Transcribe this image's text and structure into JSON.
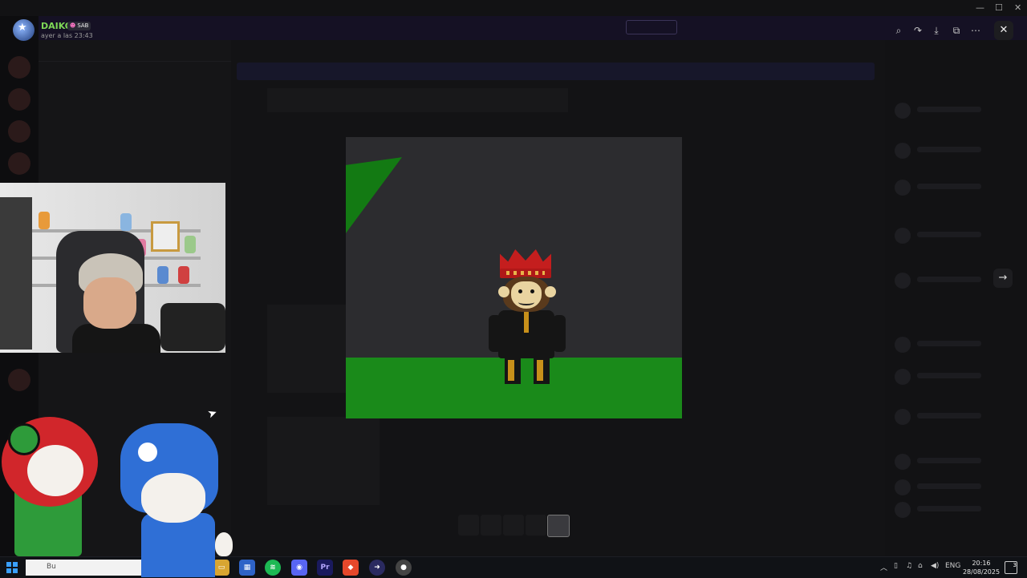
{
  "uploader": {
    "name": "DAIKO",
    "tag": "SAB",
    "timestamp": "ayer a las 23:43"
  },
  "toolbar": {
    "zoom_icon": "zoom-icon",
    "forward_icon": "forward-icon",
    "download_icon": "download-icon",
    "open_external_icon": "open-external-icon",
    "more_icon": "more-icon",
    "close_icon": "close-icon",
    "next_icon": "arrow-right-icon"
  },
  "taskbar": {
    "search_text": "Bu",
    "language": "ENG",
    "time": "20:16",
    "date": "28/08/2025",
    "notifications": "3"
  },
  "colors": {
    "accent_green": "#7ed957",
    "viewer_bg": "#0b0b0d",
    "ground": "#1a8a1a"
  }
}
